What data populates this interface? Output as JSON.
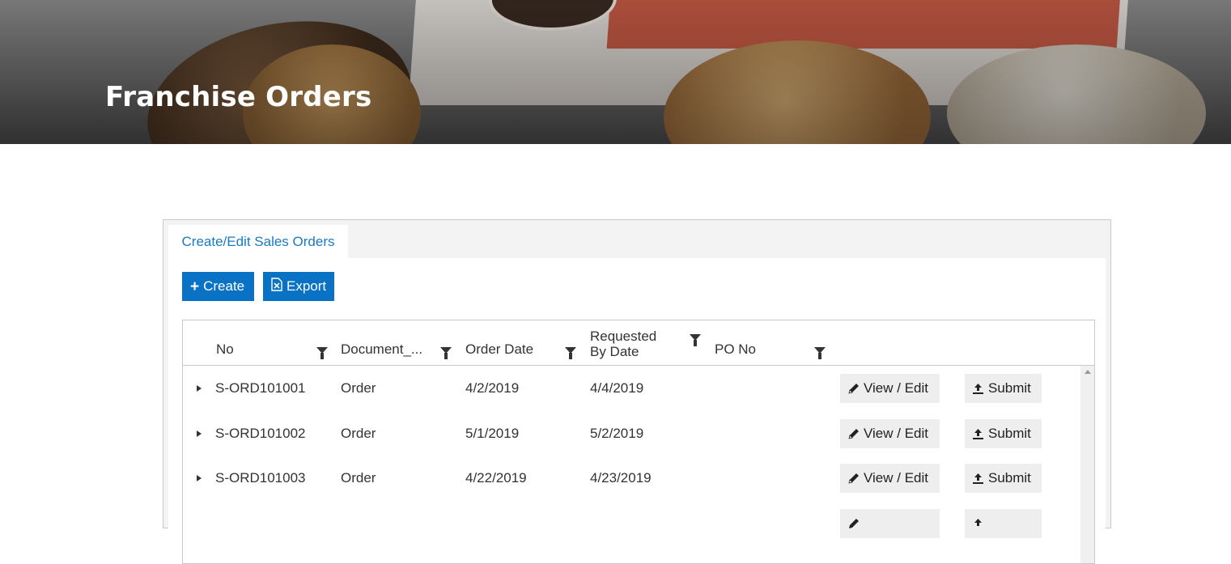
{
  "hero": {
    "title": "Franchise Orders"
  },
  "tabs": [
    {
      "label": "Create/Edit Sales Orders"
    }
  ],
  "toolbar": {
    "create_label": "Create",
    "create_icon": "plus-icon",
    "export_label": "Export",
    "export_icon": "excel-file-icon",
    "accent_color": "#0a72c4"
  },
  "grid": {
    "columns": {
      "no": "No",
      "document": "Document_...",
      "order_date": "Order Date",
      "requested_line1": "Requested",
      "requested_line2": "By Date",
      "po_no": "PO No"
    },
    "rows": [
      {
        "no": "S-ORD101001",
        "document": "Order",
        "order_date": "4/2/2019",
        "requested": "4/4/2019",
        "po_no": "",
        "view_label": "View / Edit",
        "submit_label": "Submit"
      },
      {
        "no": "S-ORD101002",
        "document": "Order",
        "order_date": "5/1/2019",
        "requested": "5/2/2019",
        "po_no": "",
        "view_label": "View / Edit",
        "submit_label": "Submit"
      },
      {
        "no": "S-ORD101003",
        "document": "Order",
        "order_date": "4/22/2019",
        "requested": "4/23/2019",
        "po_no": "",
        "view_label": "View / Edit",
        "submit_label": "Submit"
      },
      {
        "no": "",
        "document": "",
        "order_date": "",
        "requested": "",
        "po_no": "",
        "view_label": "",
        "submit_label": ""
      }
    ]
  }
}
